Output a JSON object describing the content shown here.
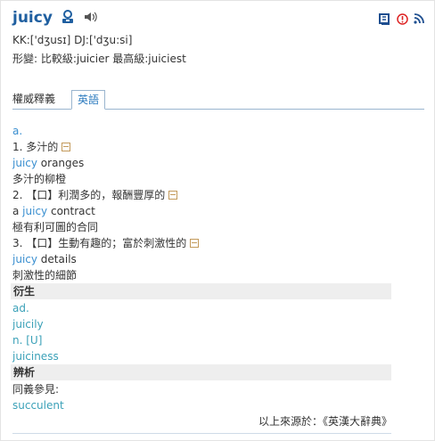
{
  "entry": {
    "word": "juicy",
    "pronunciation": "KK:['dʒusɪ] DJ:['dʒu:si]",
    "forms": "形變: 比較級:juicier  最高級:juiciest"
  },
  "tabs": [
    {
      "label": "權威釋義"
    },
    {
      "label": "英語"
    }
  ],
  "definitions": {
    "pos": "a.",
    "items": [
      {
        "head": "1. 多汁的",
        "example_word": "juicy",
        "example_rest": " oranges",
        "translation": "多汁的柳橙"
      },
      {
        "head": "2. 【口】利潤多的，報酬豐厚的",
        "example_pre": "a ",
        "example_word": "juicy",
        "example_rest": " contract",
        "translation": "極有利可圖的合同"
      },
      {
        "head": "3. 【口】生動有趣的；富於刺激性的",
        "example_word": "juicy",
        "example_rest": " details",
        "translation": "刺激性的細節"
      }
    ]
  },
  "derivatives": {
    "title": "衍生",
    "items": [
      "ad.",
      "juicily",
      "n. [U]",
      "juiciness"
    ]
  },
  "analysis": {
    "title": "辨析",
    "text": "同義參見:",
    "link": "succulent"
  },
  "source": "以上來源於：《英漢大辭典》",
  "colors": {
    "accent": "#1f5fa0",
    "link": "#3a8fd0",
    "bar": "#eeeeee"
  }
}
